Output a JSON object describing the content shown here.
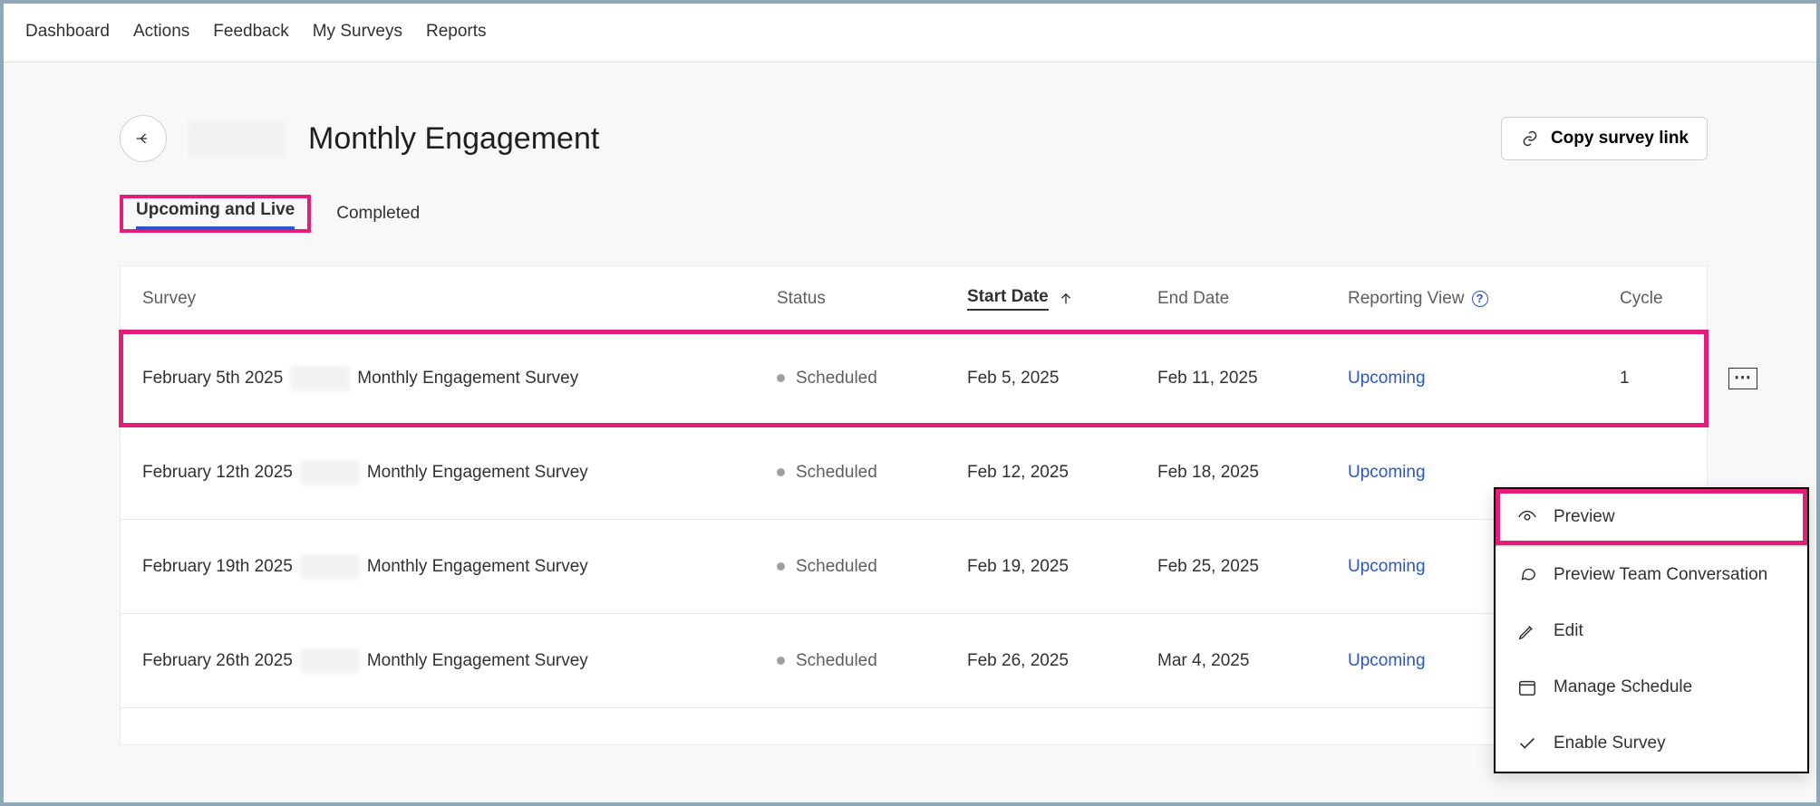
{
  "nav": {
    "items": [
      "Dashboard",
      "Actions",
      "Feedback",
      "My Surveys",
      "Reports"
    ]
  },
  "header": {
    "title_suffix": "Monthly Engagement",
    "copy_link_label": "Copy survey link"
  },
  "tabs": {
    "upcoming": "Upcoming and Live",
    "completed": "Completed"
  },
  "table": {
    "columns": {
      "survey": "Survey",
      "status": "Status",
      "start_date": "Start Date",
      "end_date": "End Date",
      "reporting_view": "Reporting View",
      "cycle": "Cycle"
    },
    "rows": [
      {
        "name_prefix": "February 5th 2025",
        "name_suffix": "Monthly Engagement Survey",
        "status": "Scheduled",
        "start": "Feb 5, 2025",
        "end": "Feb 11, 2025",
        "reporting_view": "Upcoming",
        "cycle": "1"
      },
      {
        "name_prefix": "February 12th 2025",
        "name_suffix": "Monthly Engagement Survey",
        "status": "Scheduled",
        "start": "Feb 12, 2025",
        "end": "Feb 18, 2025",
        "reporting_view": "Upcoming",
        "cycle": ""
      },
      {
        "name_prefix": "February 19th 2025",
        "name_suffix": "Monthly Engagement Survey",
        "status": "Scheduled",
        "start": "Feb 19, 2025",
        "end": "Feb 25, 2025",
        "reporting_view": "Upcoming",
        "cycle": ""
      },
      {
        "name_prefix": "February 26th 2025",
        "name_suffix": "Monthly Engagement Survey",
        "status": "Scheduled",
        "start": "Feb 26, 2025",
        "end": "Mar 4, 2025",
        "reporting_view": "Upcoming",
        "cycle": ""
      }
    ]
  },
  "menu": {
    "preview": "Preview",
    "preview_team": "Preview Team Conversation",
    "edit": "Edit",
    "manage_schedule": "Manage Schedule",
    "enable_survey": "Enable Survey"
  }
}
